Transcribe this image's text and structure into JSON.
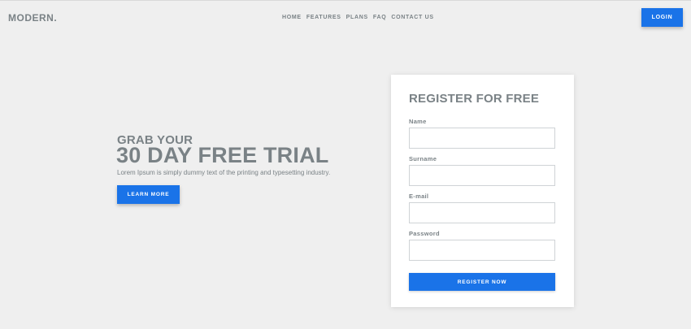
{
  "header": {
    "logo": "MODERN.",
    "nav": [
      "HOME",
      "FEATURES",
      "PLANS",
      "FAQ",
      "CONTACT US"
    ],
    "login_label": "LOGIN"
  },
  "hero": {
    "subtitle": "GRAB YOUR",
    "title": "30 DAY FREE TRIAL",
    "description": "Lorem Ipsum is simply dummy text of the printing and typesetting industry.",
    "cta_label": "LEARN MORE"
  },
  "form": {
    "title": "REGISTER FOR FREE",
    "fields": [
      {
        "label": "Name",
        "value": ""
      },
      {
        "label": "Surname",
        "value": ""
      },
      {
        "label": "E-mail",
        "value": ""
      },
      {
        "label": "Password",
        "value": ""
      }
    ],
    "submit_label": "REGISTER NOW"
  },
  "colors": {
    "accent": "#1a73e8",
    "text": "#7a8286",
    "background": "#efefef"
  }
}
